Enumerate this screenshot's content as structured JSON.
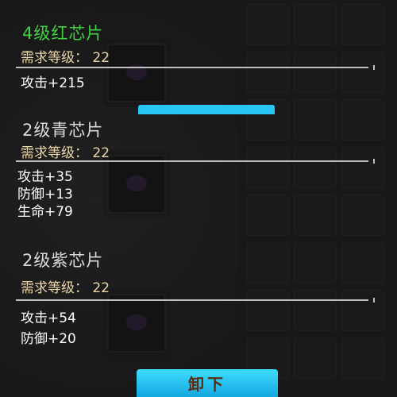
{
  "chips": [
    {
      "title": "4级红芯片",
      "title_color": "#3ed13e",
      "requirement": "需求等级： 22",
      "stats": [
        "攻击+215"
      ]
    },
    {
      "title": "2级青芯片",
      "title_color": "#d9d9d9",
      "requirement": "需求等级： 22",
      "stats": [
        "攻击+35",
        "防御+13",
        "生命+79"
      ]
    },
    {
      "title": "2级紫芯片",
      "title_color": "#d9d9d9",
      "requirement": "需求等级： 22",
      "stats": [
        "攻击+54",
        "防御+20"
      ]
    }
  ],
  "unload_button": "卸下",
  "colors": {
    "accent": "#28c6f2",
    "requirement_text": "#ead6a6",
    "button_text": "#5a2c10"
  }
}
